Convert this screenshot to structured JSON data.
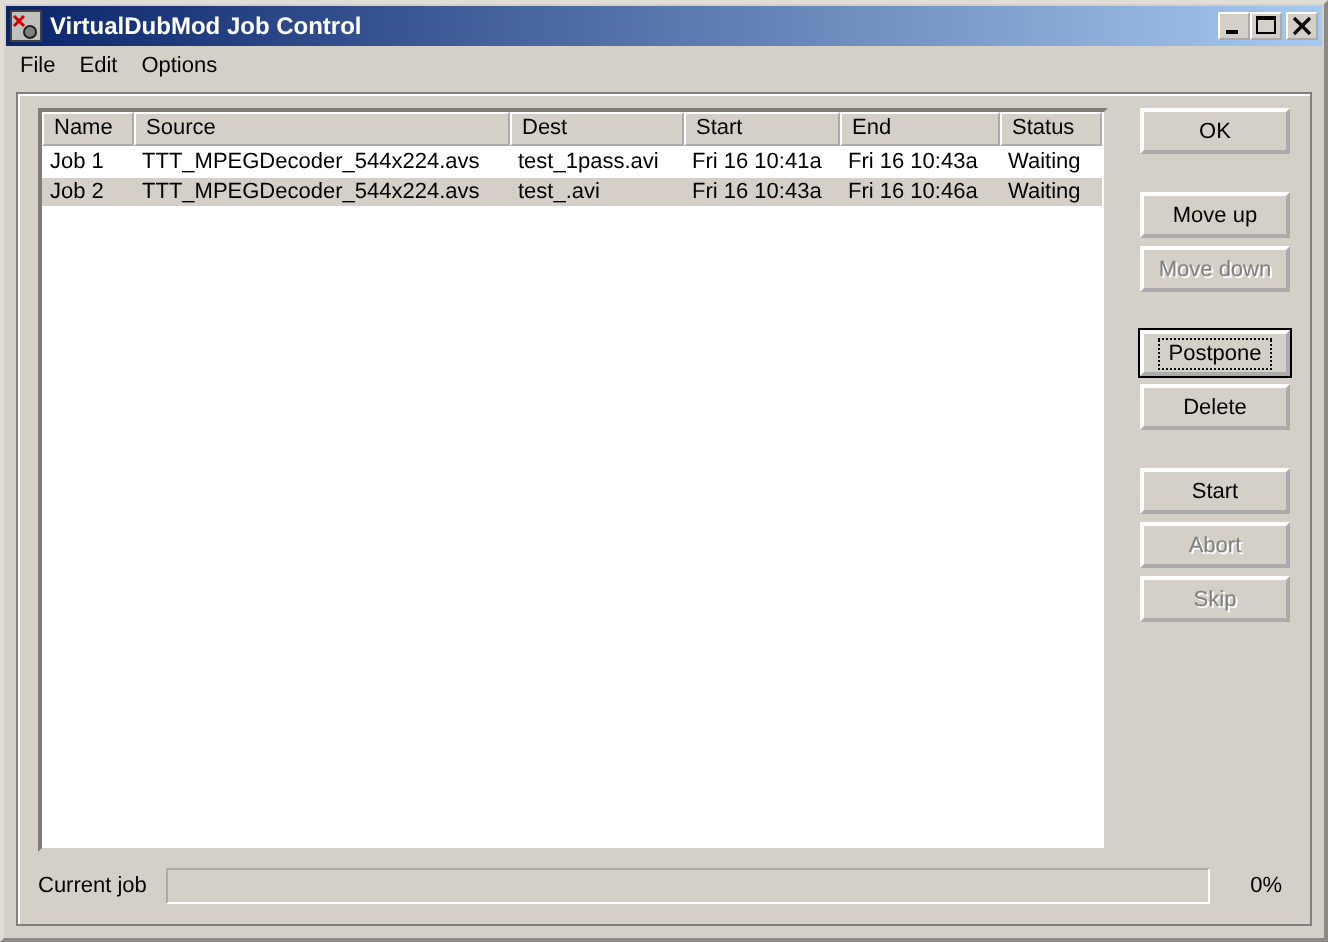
{
  "window": {
    "title": "VirtualDubMod Job Control"
  },
  "menu": [
    "File",
    "Edit",
    "Options"
  ],
  "table": {
    "columns": [
      "Name",
      "Source",
      "Dest",
      "Start",
      "End",
      "Status"
    ],
    "rows": [
      {
        "cells": [
          "Job 1",
          "TTT_MPEGDecoder_544x224.avs",
          "test_1pass.avi",
          "Fri 16 10:41a",
          "Fri 16 10:43a",
          "Waiting"
        ],
        "selected": false
      },
      {
        "cells": [
          "Job 2",
          "TTT_MPEGDecoder_544x224.avs",
          "test_.avi",
          "Fri 16 10:43a",
          "Fri 16 10:46a",
          "Waiting"
        ],
        "selected": true
      }
    ]
  },
  "button_groups": [
    [
      {
        "label": "OK",
        "disabled": false,
        "focused": false
      }
    ],
    [
      {
        "label": "Move up",
        "disabled": false,
        "focused": false
      },
      {
        "label": "Move down",
        "disabled": true,
        "focused": false
      }
    ],
    [
      {
        "label": "Postpone",
        "disabled": false,
        "focused": true
      },
      {
        "label": "Delete",
        "disabled": false,
        "focused": false
      }
    ],
    [
      {
        "label": "Start",
        "disabled": false,
        "focused": false
      },
      {
        "label": "Abort",
        "disabled": true,
        "focused": false
      },
      {
        "label": "Skip",
        "disabled": true,
        "focused": false
      }
    ]
  ],
  "progress": {
    "label": "Current job",
    "level": 0,
    "reading": "0%"
  }
}
